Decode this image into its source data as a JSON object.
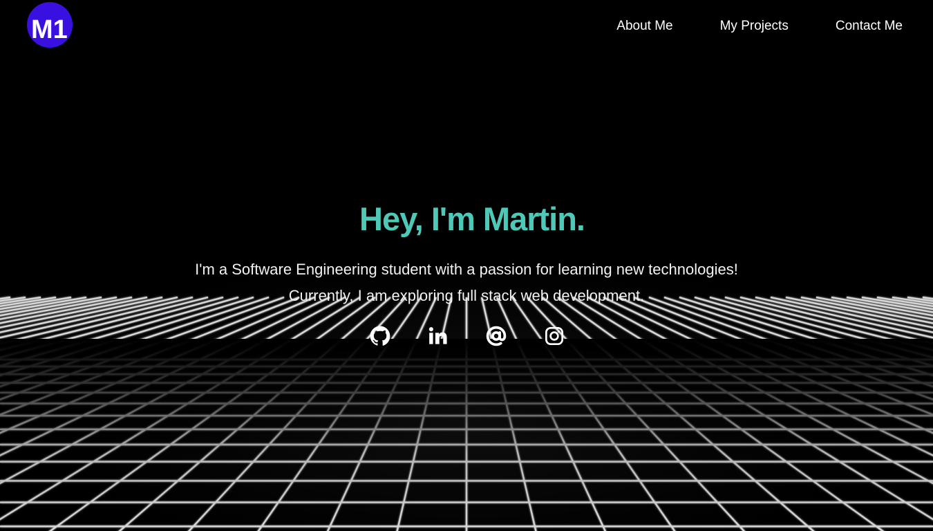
{
  "logo": {
    "text": "M1",
    "bg_color": "#3a10e0"
  },
  "nav": {
    "items": [
      {
        "label": "About Me"
      },
      {
        "label": "My Projects"
      },
      {
        "label": "Contact Me"
      }
    ]
  },
  "hero": {
    "title": "Hey, I'm Martin.",
    "title_color": "#4ec9b8",
    "intro_line_1": "I'm a Software Engineering student with a passion for learning new technologies!",
    "intro_line_2": "Currently, I am exploring full stack web development."
  },
  "socials": [
    {
      "icon": "github-icon"
    },
    {
      "icon": "linkedin-icon"
    },
    {
      "icon": "at-sign-icon"
    },
    {
      "icon": "instagram-icon"
    }
  ],
  "colors": {
    "background": "#000000",
    "text": "#ffffff",
    "accent": "#4ec9b8",
    "grid_line": "#d8d8d8"
  }
}
